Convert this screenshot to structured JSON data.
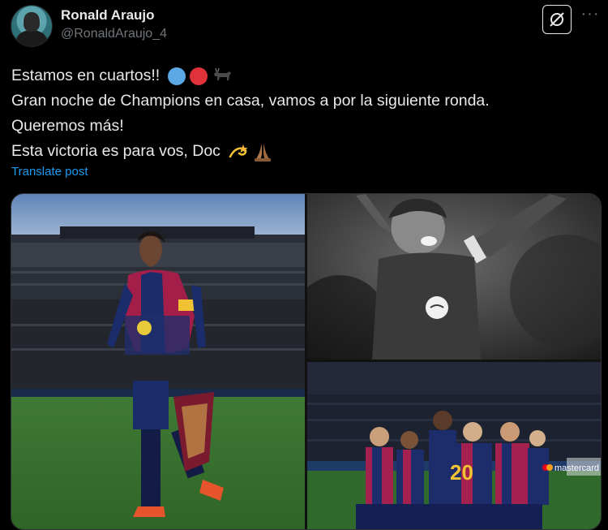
{
  "author": {
    "name": "Ronald Araujo",
    "handle": "@RonaldAraujo_4"
  },
  "post": {
    "lines": [
      "Estamos en cuartos!!",
      "Gran noche de Champions en casa, vamos a por la siguiente ronda.",
      "Queremos más!",
      "Esta victoria es para vos, Doc"
    ],
    "emojis": {
      "line1": [
        "blue-circle",
        "red-circle",
        "goat"
      ],
      "line4": [
        "dizzy",
        "folded-hands"
      ]
    },
    "translate_label": "Translate post"
  },
  "media": {
    "photos": [
      {
        "alt_icon": "player-walking-photo"
      },
      {
        "alt_icon": "player-celebrating-bw-photo"
      },
      {
        "alt_icon": "team-huddle-photo"
      }
    ],
    "visible_text": {
      "shirt_number": "20",
      "sponsor": "mastercard"
    }
  },
  "colors": {
    "background": "#000000",
    "text": "#e7e9ea",
    "muted": "#71767b",
    "link": "#1d9bf0",
    "blue_circle": "#5aa9e6",
    "red_circle": "#e0323a"
  }
}
